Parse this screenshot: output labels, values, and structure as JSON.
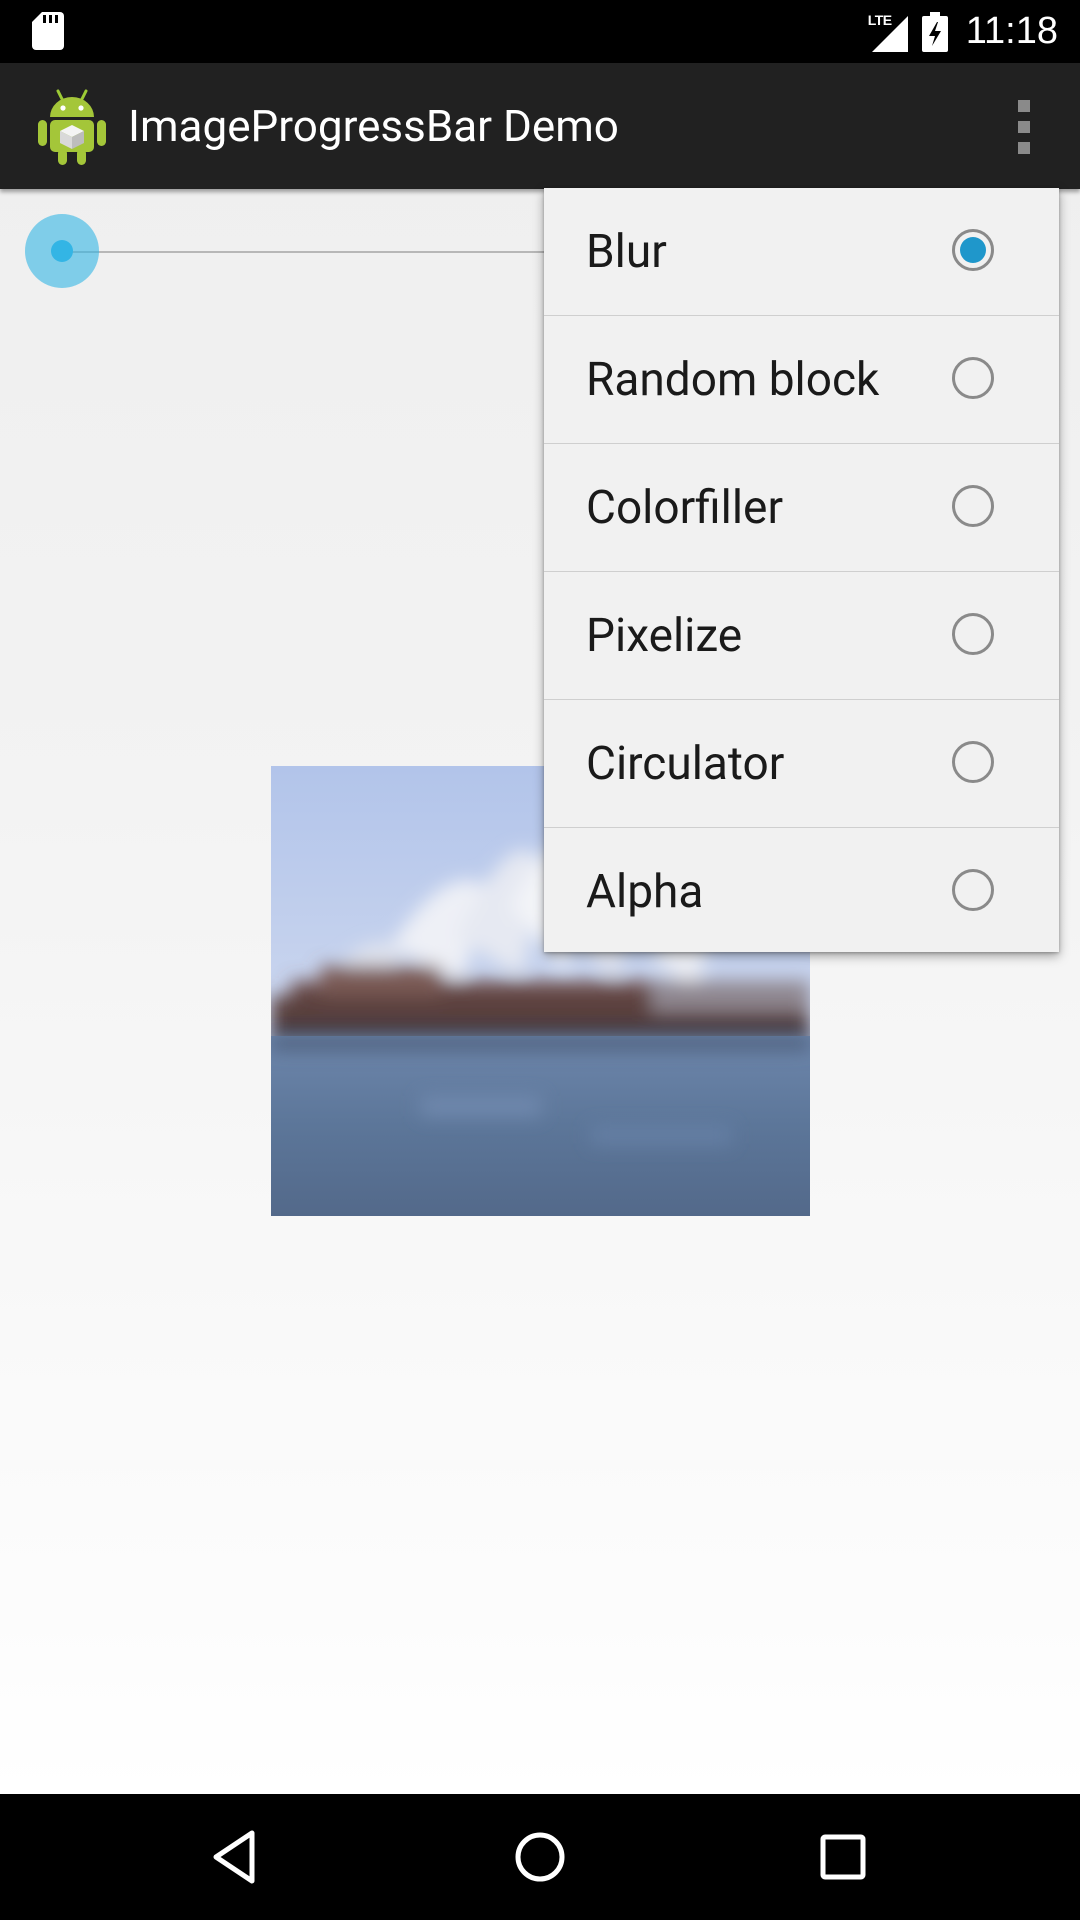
{
  "status_bar": {
    "network_label": "LTE",
    "time": "11:18",
    "icons": [
      "sd-card-icon",
      "signal-icon",
      "battery-charging-icon"
    ]
  },
  "action_bar": {
    "app_icon": "android-robot-icon",
    "title": "ImageProgressBar Demo",
    "overflow_icon": "overflow-menu-icon"
  },
  "seekbar": {
    "progress": 0,
    "accent_color": "#33b5e5"
  },
  "image": {
    "icon": "sydney-opera-house-blurred-image"
  },
  "menu": {
    "selected": "Blur",
    "accent_color": "#1f97cb",
    "items": [
      {
        "label": "Blur",
        "checked": true
      },
      {
        "label": "Random block",
        "checked": false
      },
      {
        "label": "Colorfiller",
        "checked": false
      },
      {
        "label": "Pixelize",
        "checked": false
      },
      {
        "label": "Circulator",
        "checked": false
      },
      {
        "label": "Alpha",
        "checked": false
      }
    ]
  },
  "nav_bar": {
    "icons": [
      "back-icon",
      "home-icon",
      "recents-icon"
    ]
  }
}
